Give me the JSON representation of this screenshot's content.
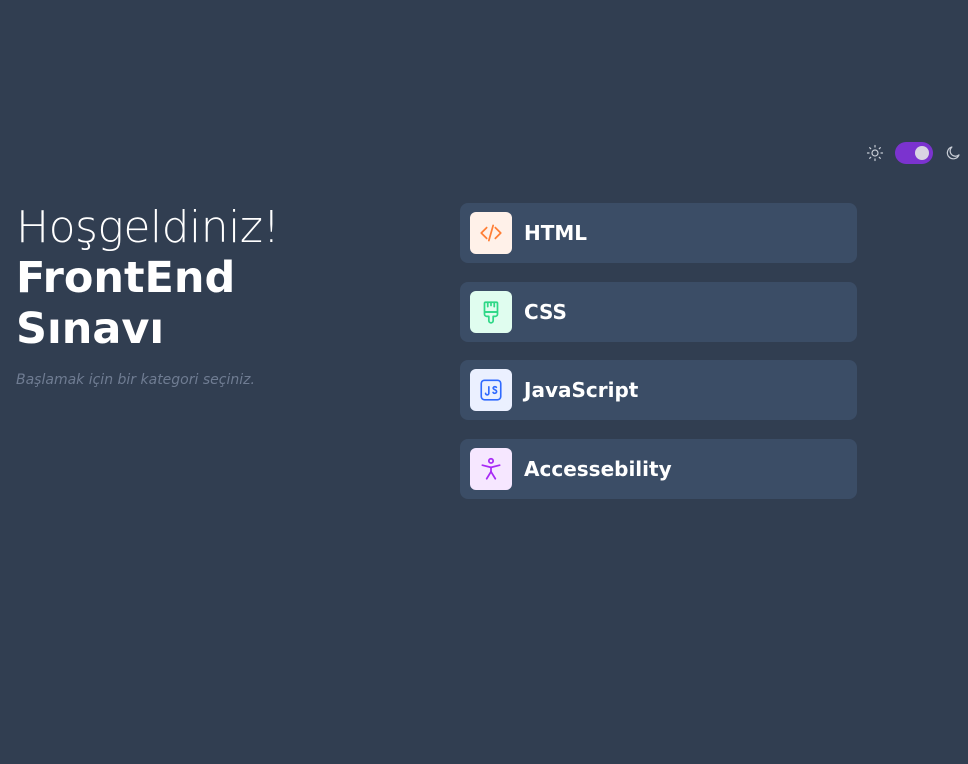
{
  "theme": {
    "light_icon": "sun-icon",
    "dark_icon": "moon-icon",
    "mode": "dark",
    "toggle_color": "#7b33cf"
  },
  "welcome": {
    "greeting": "Hoşgeldiniz!",
    "title_line1": "FrontEnd",
    "title_line2": "Sınavı",
    "subtitle": "Başlamak için bir kategori seçiniz."
  },
  "categories": [
    {
      "label": "HTML",
      "icon": "code-icon",
      "icon_bg": "#fff1e9",
      "icon_color": "#ff7e35"
    },
    {
      "label": "CSS",
      "icon": "paint-brush-icon",
      "icon_bg": "#e0fdef",
      "icon_color": "#2fd887"
    },
    {
      "label": "JavaScript",
      "icon": "js-icon",
      "icon_bg": "#ebf0ff",
      "icon_color": "#306aff"
    },
    {
      "label": "Accessebility",
      "icon": "accessibility-icon",
      "icon_bg": "#f6e7ff",
      "icon_color": "#a729f5"
    }
  ]
}
